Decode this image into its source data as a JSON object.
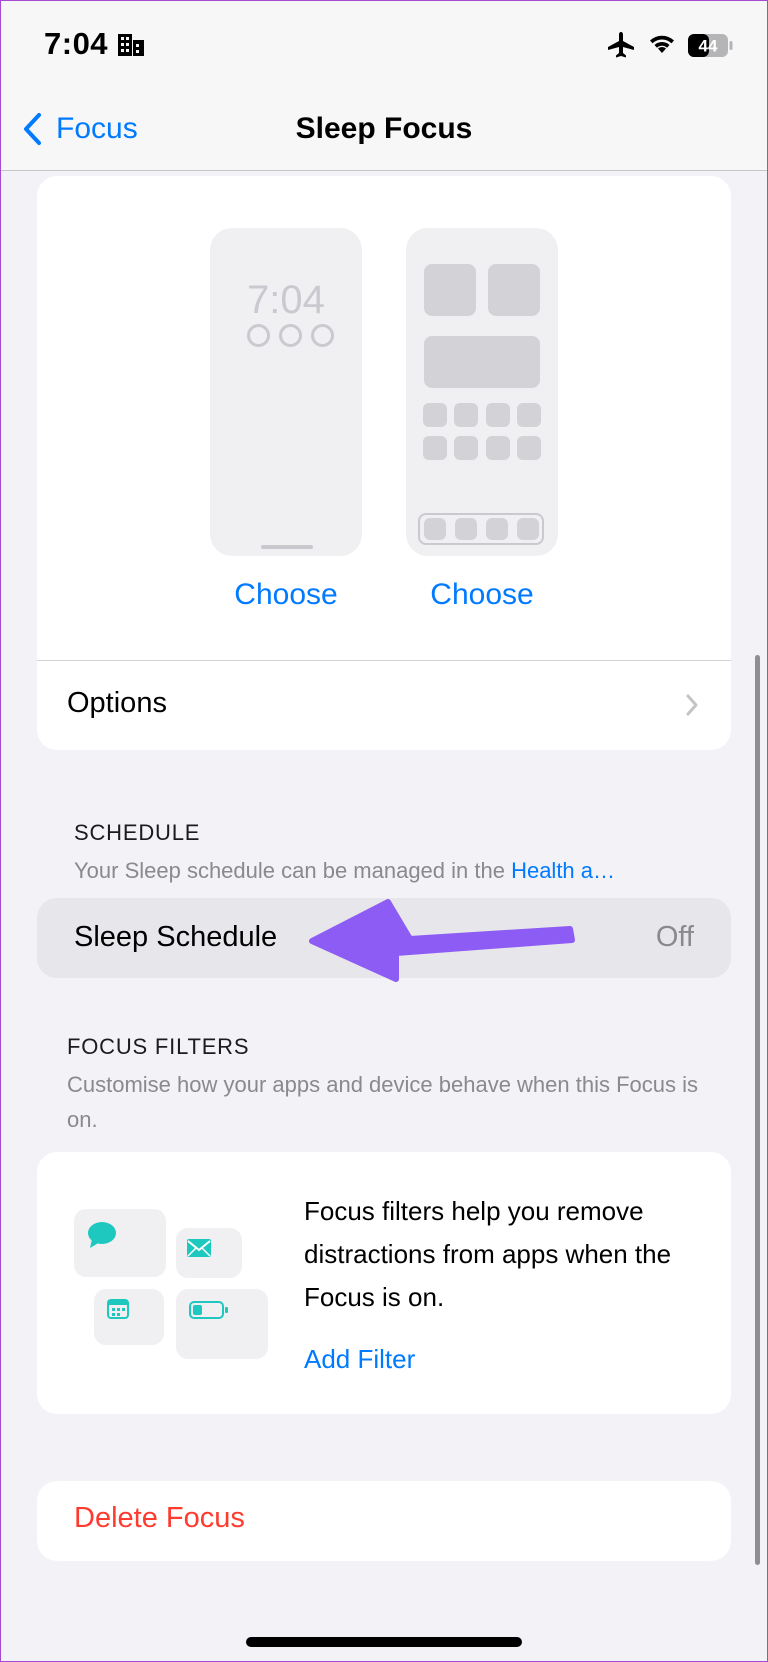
{
  "status_bar": {
    "time": "7:04",
    "battery": "44"
  },
  "nav": {
    "back_label": "Focus",
    "title": "Sleep Focus"
  },
  "customize": {
    "lock_preview_time": "7:04",
    "choose_lock": "Choose",
    "choose_home": "Choose",
    "options_label": "Options"
  },
  "schedule": {
    "header": "SCHEDULE",
    "subtitle_prefix": "Your Sleep schedule can be managed in the ",
    "subtitle_link": "Health a…",
    "row_label": "Sleep Schedule",
    "row_value": "Off"
  },
  "focus_filters": {
    "header": "FOCUS FILTERS",
    "subtitle": "Customise how your apps and device behave when this Focus is on.",
    "description": "Focus filters help you remove distractions from apps when the Focus is on.",
    "add_filter": "Add Filter"
  },
  "delete_label": "Delete Focus",
  "colors": {
    "accent": "#007aff",
    "destructive": "#ff3b30",
    "filter_icon": "#1ec8be",
    "annotation_arrow": "#8c5cf5"
  }
}
